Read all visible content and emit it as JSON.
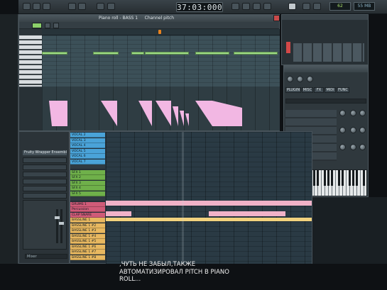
{
  "transport": {
    "clock": "37:03:000",
    "cpu": "62",
    "mem": "55 MB"
  },
  "piano_roll": {
    "title": "Piano roll - BASS 1",
    "subtitle_label": "Channel pitch"
  },
  "channel_rack": {
    "plugin_row": "Fruity Wrapper Ensemble",
    "label": "Mixer"
  },
  "plugin": {
    "tabs": [
      "PLUGIN",
      "MISC",
      "FX",
      "MIDI",
      "FUNC"
    ]
  },
  "playlist": {
    "tracks": [
      {
        "label": "VOCAL 2",
        "color": "#4aa3d8"
      },
      {
        "label": "VOCAL 3",
        "color": "#4aa3d8"
      },
      {
        "label": "VOCAL 4",
        "color": "#4aa3d8"
      },
      {
        "label": "VOCAL 5",
        "color": "#4aa3d8"
      },
      {
        "label": "VOCAL 6",
        "color": "#4aa3d8"
      },
      {
        "label": "VOCAL 7",
        "color": "#4aa3d8"
      },
      {
        "label": "",
        "color": "#2f3a41"
      },
      {
        "label": "SFX 1",
        "color": "#6fb04a"
      },
      {
        "label": "SFX 2",
        "color": "#6fb04a"
      },
      {
        "label": "SFX 3",
        "color": "#6fb04a"
      },
      {
        "label": "SFX 4",
        "color": "#6fb04a"
      },
      {
        "label": "SFX 5",
        "color": "#6fb04a"
      },
      {
        "label": "",
        "color": "#2f3a41"
      },
      {
        "label": "DRUMS 1",
        "color": "#d05b78"
      },
      {
        "label": "Percussion",
        "color": "#d05b78"
      },
      {
        "label": "CLAP SNARE",
        "color": "#d05b78"
      },
      {
        "label": "BASSLINE 1",
        "color": "#e8b860"
      },
      {
        "label": "BASSLINE 1 #2",
        "color": "#e8b860"
      },
      {
        "label": "BASSLINE 1 #3",
        "color": "#e8b860"
      },
      {
        "label": "BASSLINE 1 #4",
        "color": "#e8b860"
      },
      {
        "label": "BASSLINE 1 #5",
        "color": "#e8b860"
      },
      {
        "label": "BASSLINE 1 #6",
        "color": "#e8b860"
      },
      {
        "label": "BASSLINE 1 #7",
        "color": "#e8b860"
      },
      {
        "label": "BASSLINE 1 #8",
        "color": "#e8b860"
      }
    ]
  },
  "subtitle": {
    "line1": ",ЧУТЬ НЕ ЗАБЫЛ,ТАКЖЕ",
    "line2": "АВТОМАТИЗИРОВАЛ PITCH В PIANO",
    "line3": "ROLL..."
  }
}
